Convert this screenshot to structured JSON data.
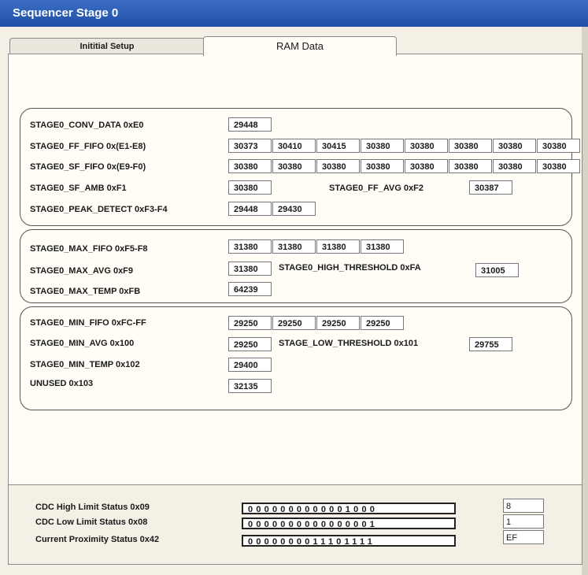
{
  "window": {
    "title": "Sequencer Stage 0"
  },
  "tabs": [
    {
      "label": "Inititial Setup"
    },
    {
      "label": "RAM Data"
    }
  ],
  "group1": {
    "conv": {
      "label": "STAGE0_CONV_DATA 0xE0",
      "value": "29448"
    },
    "ff_fifo": {
      "label": "STAGE0_FF_FIFO 0x(E1-E8)",
      "values": [
        "30373",
        "30410",
        "30415",
        "30380",
        "30380",
        "30380",
        "30380",
        "30380"
      ]
    },
    "sf_fifo": {
      "label": "STAGE0_SF_FIFO 0x(E9-F0)",
      "values": [
        "30380",
        "30380",
        "30380",
        "30380",
        "30380",
        "30380",
        "30380",
        "30380"
      ]
    },
    "sf_amb": {
      "label": "STAGE0_SF_AMB 0xF1",
      "value": "30380"
    },
    "ff_avg": {
      "label": "STAGE0_FF_AVG 0xF2",
      "value": "30387"
    },
    "peak": {
      "label": "STAGE0_PEAK_DETECT 0xF3-F4",
      "values": [
        "29448",
        "29430"
      ]
    }
  },
  "group2": {
    "max_fifo": {
      "label": "STAGE0_MAX_FIFO 0xF5-F8",
      "values": [
        "31380",
        "31380",
        "31380",
        "31380"
      ]
    },
    "max_avg": {
      "label": "STAGE0_MAX_AVG 0xF9",
      "value": "31380"
    },
    "high_thr": {
      "label": "STAGE0_HIGH_THRESHOLD 0xFA",
      "value": "31005"
    },
    "max_temp": {
      "label": "STAGE0_MAX_TEMP 0xFB",
      "value": "64239"
    }
  },
  "group3": {
    "min_fifo": {
      "label": "STAGE0_MIN_FIFO 0xFC-FF",
      "values": [
        "29250",
        "29250",
        "29250",
        "29250"
      ]
    },
    "min_avg": {
      "label": "STAGE0_MIN_AVG 0x100",
      "value": "29250"
    },
    "low_thr": {
      "label": "STAGE_LOW_THRESHOLD 0x101",
      "value": "29755"
    },
    "min_temp": {
      "label": "STAGE0_MIN_TEMP  0x102",
      "value": "29400"
    },
    "unused": {
      "label": "UNUSED 0x103",
      "value": "32135"
    }
  },
  "status": [
    {
      "label": "CDC High Limit Status 0x09",
      "bits": "0000000000001000",
      "value": "8"
    },
    {
      "label": "CDC Low Limit Status 0x08",
      "bits": "0000000000000001",
      "value": "1"
    },
    {
      "label": "Current Proximity Status 0x42",
      "bits": "0000000011101111",
      "value": "EF"
    }
  ]
}
